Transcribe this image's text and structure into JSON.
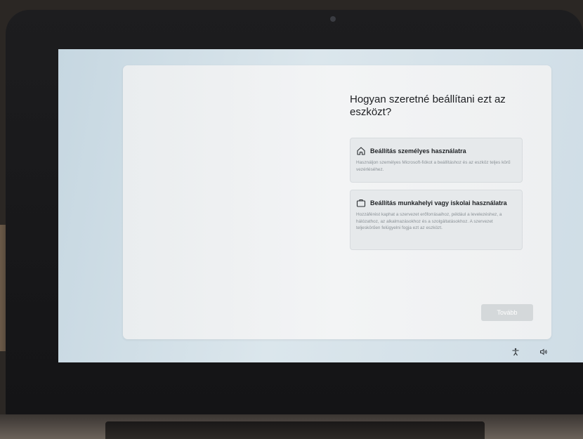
{
  "oobe": {
    "question": "Hogyan szeretné beállítani ezt az eszközt?",
    "options": [
      {
        "icon": "home-icon",
        "title": "Beállítás személyes használatra",
        "description": "Használjon személyes Microsoft-fiókot a beállításhoz és az eszköz teljes körű vezérléséhez."
      },
      {
        "icon": "briefcase-icon",
        "title": "Beállítás munkahelyi vagy iskolai használatra",
        "description": "Hozzáférést kaphat a szervezet erőforrásaihoz, például a levelezéshez, a hálózathoz, az alkalmazásokhoz és a szolgáltatásokhoz. A szervezet teljeskörűen felügyelni fogja ezt az eszközt."
      }
    ],
    "next_label": "Tovább"
  },
  "tray": {
    "accessibility_icon": "accessibility-icon",
    "volume_icon": "volume-icon"
  },
  "colors": {
    "screen_background": "#cfdde6",
    "card": "#f1f2f3",
    "next_button_disabled": "#d4d8da"
  }
}
